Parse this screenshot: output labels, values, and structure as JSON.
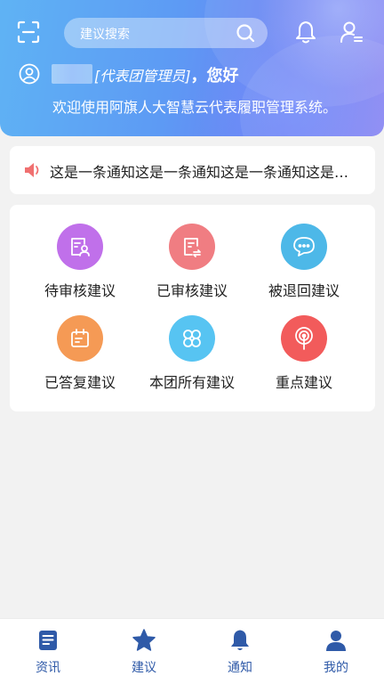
{
  "header": {
    "search_placeholder": "建议搜索",
    "user_role": "[代表团管理员]",
    "greeting": "，您好",
    "welcome_text": "欢迎使用阿旗人大智慧云代表履职管理系统。"
  },
  "notice": {
    "text": "这是一条通知这是一条通知这是一条通知这是一条通知"
  },
  "grid": {
    "items": [
      {
        "label": "待审核建议",
        "color": "#c070ea",
        "icon": "pending-review-icon"
      },
      {
        "label": "已审核建议",
        "color": "#f07d82",
        "icon": "reviewed-icon"
      },
      {
        "label": "被退回建议",
        "color": "#4db8e8",
        "icon": "returned-chat-icon"
      },
      {
        "label": "已答复建议",
        "color": "#f59a55",
        "icon": "answered-calendar-icon"
      },
      {
        "label": "本团所有建议",
        "color": "#57c4f2",
        "icon": "clover-icon"
      },
      {
        "label": "重点建议",
        "color": "#f25b5b",
        "icon": "key-signal-icon"
      }
    ]
  },
  "tabbar": {
    "tabs": [
      {
        "label": "资讯",
        "icon": "document-icon"
      },
      {
        "label": "建议",
        "icon": "star-icon"
      },
      {
        "label": "通知",
        "icon": "bell-icon"
      },
      {
        "label": "我的",
        "icon": "person-icon"
      }
    ],
    "accent": "#2f5aa8"
  }
}
